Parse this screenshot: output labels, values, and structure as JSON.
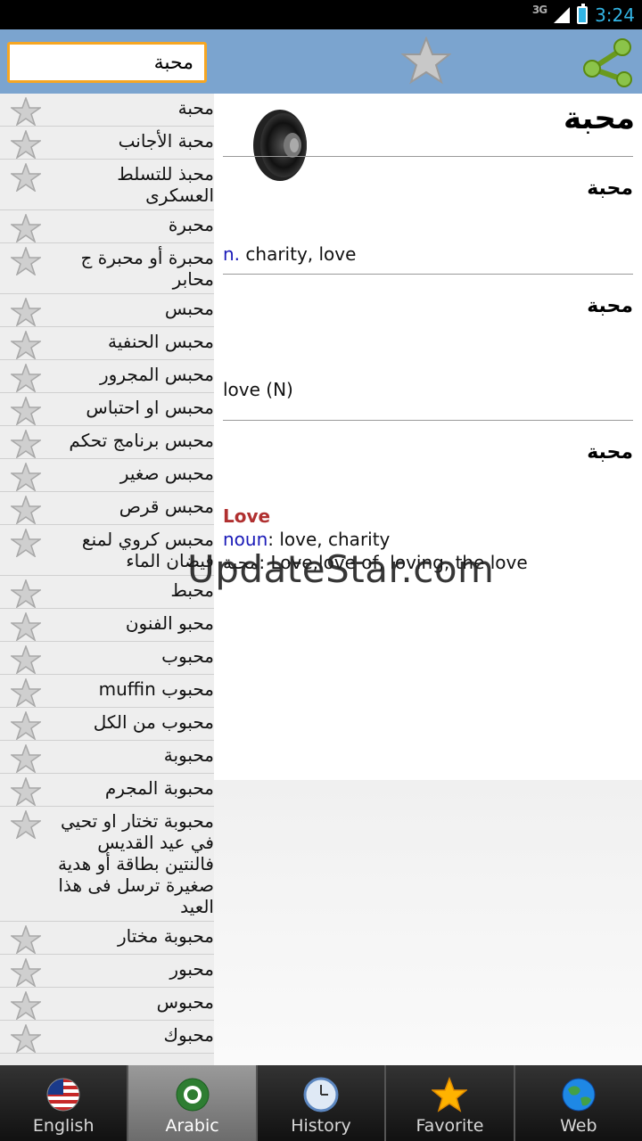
{
  "status_bar": {
    "network": "3G",
    "time": "3:24"
  },
  "search": {
    "value": "محبة"
  },
  "word_list": [
    {
      "text": "محبة"
    },
    {
      "text": "محبة الأجانب"
    },
    {
      "text": "محبذ للتسلط العسكرى"
    },
    {
      "text": "محبرة"
    },
    {
      "text": "محبرة أو محبرة ج محابر"
    },
    {
      "text": "محبس"
    },
    {
      "text": "محبس الحنفية"
    },
    {
      "text": "محبس المجرور"
    },
    {
      "text": "محبس او احتباس"
    },
    {
      "text": "محبس برنامج تحكم"
    },
    {
      "text": "محبس صغير"
    },
    {
      "text": "محبس قرص"
    },
    {
      "text": "محبس كروي لمنع فيضان الماء"
    },
    {
      "text": "محبط"
    },
    {
      "text": "محبو الفنون"
    },
    {
      "text": "محبوب"
    },
    {
      "text": "محبوب muffin"
    },
    {
      "text": "محبوب من الكل"
    },
    {
      "text": "محبوبة"
    },
    {
      "text": "محبوبة المجرم"
    },
    {
      "text": "محبوبة تختار او تحيي في عيد القديس فالنتين بطاقة أو هدية صغيرة ترسل فى هذا العيد"
    },
    {
      "text": "محبوبة مختار"
    },
    {
      "text": "محبور"
    },
    {
      "text": "محبوس"
    },
    {
      "text": "محبوك"
    }
  ],
  "entry": {
    "headword": "محبة",
    "sections": [
      {
        "word": "محبة",
        "pos": "n.",
        "definition": " charity, love"
      },
      {
        "word": "محبة",
        "definition": "love (N)"
      },
      {
        "word": "محبة",
        "title": "Love",
        "pos": "noun",
        "definition": ": love, charity",
        "example": "محبة: Love,love of, loving, the love"
      }
    ]
  },
  "watermark": "UpdateStar.com",
  "tabs": [
    {
      "label": "English",
      "icon": "us-flag-icon",
      "active": false
    },
    {
      "label": "Arabic",
      "icon": "arab-league-icon",
      "active": true
    },
    {
      "label": "History",
      "icon": "clock-icon",
      "active": false
    },
    {
      "label": "Favorite",
      "icon": "star-icon",
      "active": false
    },
    {
      "label": "Web",
      "icon": "globe-icon",
      "active": false
    }
  ]
}
